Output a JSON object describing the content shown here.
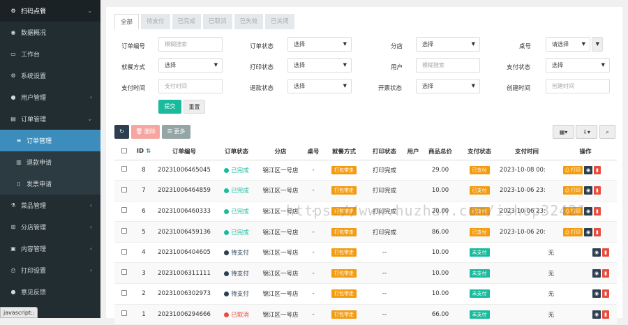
{
  "sidebar": {
    "items": [
      {
        "label": "扫码点餐",
        "icon": "cubes-icon",
        "arrow": "⌄"
      },
      {
        "label": "数据概况",
        "icon": "dashboard-icon",
        "arrow": ""
      },
      {
        "label": "工作台",
        "icon": "monitor-icon",
        "arrow": ""
      },
      {
        "label": "系统设置",
        "icon": "cogs-icon",
        "arrow": ""
      },
      {
        "label": "用户管理",
        "icon": "user-icon",
        "arrow": "‹"
      },
      {
        "label": "订单管理",
        "icon": "list-icon",
        "arrow": "⌄"
      },
      {
        "label": "订单管理",
        "icon": "list-lines-icon",
        "arrow": ""
      },
      {
        "label": "退款申请",
        "icon": "bank-icon",
        "arrow": ""
      },
      {
        "label": "发票申请",
        "icon": "file-icon",
        "arrow": ""
      },
      {
        "label": "菜品管理",
        "icon": "flask-icon",
        "arrow": "‹"
      },
      {
        "label": "分店管理",
        "icon": "sitemap-icon",
        "arrow": "‹"
      },
      {
        "label": "内容管理",
        "icon": "inbox-icon",
        "arrow": "‹"
      },
      {
        "label": "打印设置",
        "icon": "print-icon",
        "arrow": "‹"
      },
      {
        "label": "意见反馈",
        "icon": "comment-icon",
        "arrow": ""
      }
    ]
  },
  "status_bar": "javascript:;",
  "tabs": [
    "全部",
    "待支付",
    "已完成",
    "已取消",
    "已失效",
    "已关闭"
  ],
  "filters": {
    "order_no": {
      "label": "订单编号",
      "placeholder": "模糊搜索"
    },
    "order_status": {
      "label": "订单状态",
      "value": "选择"
    },
    "branch": {
      "label": "分店",
      "value": "选择"
    },
    "table_no": {
      "label": "桌号",
      "value": "请选择"
    },
    "dine_type": {
      "label": "就餐方式",
      "value": "选择"
    },
    "print_status": {
      "label": "打印状态",
      "value": "选择"
    },
    "user": {
      "label": "用户",
      "placeholder": "模糊搜索"
    },
    "pay_status": {
      "label": "支付状态",
      "value": "选择"
    },
    "pay_time": {
      "label": "支付时间",
      "placeholder": "支付时间"
    },
    "refund_status": {
      "label": "退款状态",
      "value": "选择"
    },
    "invoice_status": {
      "label": "开票状态",
      "value": "选择"
    },
    "create_time": {
      "label": "创建时间",
      "placeholder": "创建时间"
    },
    "submit": "提交",
    "reset": "重置"
  },
  "toolbar": {
    "delete": "删除",
    "more": "更多"
  },
  "table": {
    "headers": [
      "ID",
      "订单编号",
      "订单状态",
      "分店",
      "桌号",
      "就餐方式",
      "打印状态",
      "用户",
      "商品总价",
      "支付状态",
      "支付时间",
      "操作"
    ],
    "rows": [
      {
        "id": "8",
        "no": "20231006465045",
        "status": "已完成",
        "branch": "锦江区一号店",
        "table": "-",
        "dine": "打包带走",
        "print": "打印完成",
        "user": "",
        "total": "29.00",
        "pay": "已支付",
        "paytime": "2023-10-08 00:",
        "ops": [
          "打印",
          "",
          ""
        ]
      },
      {
        "id": "7",
        "no": "20231006464859",
        "status": "已完成",
        "branch": "锦江区一号店",
        "table": "-",
        "dine": "打包带走",
        "print": "打印完成",
        "user": "",
        "total": "10.00",
        "pay": "已支付",
        "paytime": "2023-10-06 23:",
        "ops": [
          "打印",
          "",
          ""
        ]
      },
      {
        "id": "6",
        "no": "20231006460333",
        "status": "已完成",
        "branch": "锦江区一号店",
        "table": "-",
        "dine": "打包带走",
        "print": "打印完成",
        "user": "",
        "total": "20.00",
        "pay": "已支付",
        "paytime": "2023-10-06 23:",
        "ops": [
          "打印",
          "",
          ""
        ]
      },
      {
        "id": "5",
        "no": "20231006459136",
        "status": "已完成",
        "branch": "锦江区一号店",
        "table": "-",
        "dine": "打包带走",
        "print": "打印完成",
        "user": "",
        "total": "86.00",
        "pay": "已支付",
        "paytime": "2023-10-06 20:",
        "ops": [
          "打印",
          "",
          ""
        ]
      },
      {
        "id": "4",
        "no": "20231006404605",
        "status": "待支付",
        "branch": "锦江区一号店",
        "table": "-",
        "dine": "打包带走",
        "print": "--",
        "user": "",
        "total": "10.00",
        "pay": "未支付",
        "paytime": "无",
        "ops": [
          "",
          ""
        ]
      },
      {
        "id": "3",
        "no": "20231006311111",
        "status": "待支付",
        "branch": "锦江区一号店",
        "table": "-",
        "dine": "打包带走",
        "print": "--",
        "user": "",
        "total": "10.00",
        "pay": "未支付",
        "paytime": "无",
        "ops": [
          "",
          ""
        ]
      },
      {
        "id": "2",
        "no": "20231006302973",
        "status": "待支付",
        "branch": "锦江区一号店",
        "table": "-",
        "dine": "打包带走",
        "print": "--",
        "user": "",
        "total": "10.00",
        "pay": "未支付",
        "paytime": "无",
        "ops": [
          "",
          ""
        ]
      },
      {
        "id": "1",
        "no": "20231006294666",
        "status": "已取消",
        "branch": "锦江区一号店",
        "table": "-",
        "dine": "打包带走",
        "print": "--",
        "user": "",
        "total": "66.00",
        "pay": "未支付",
        "paytime": "无",
        "ops": [
          "",
          ""
        ]
      }
    ]
  },
  "watermark": "https://www.huzhan.com/ishop32421",
  "colors": {
    "sidebar": "#222d32",
    "active": "#3c8dbc",
    "green": "#18bc9c",
    "orange": "#f39c12",
    "red": "#e74c3c",
    "navy": "#2c3e50"
  }
}
